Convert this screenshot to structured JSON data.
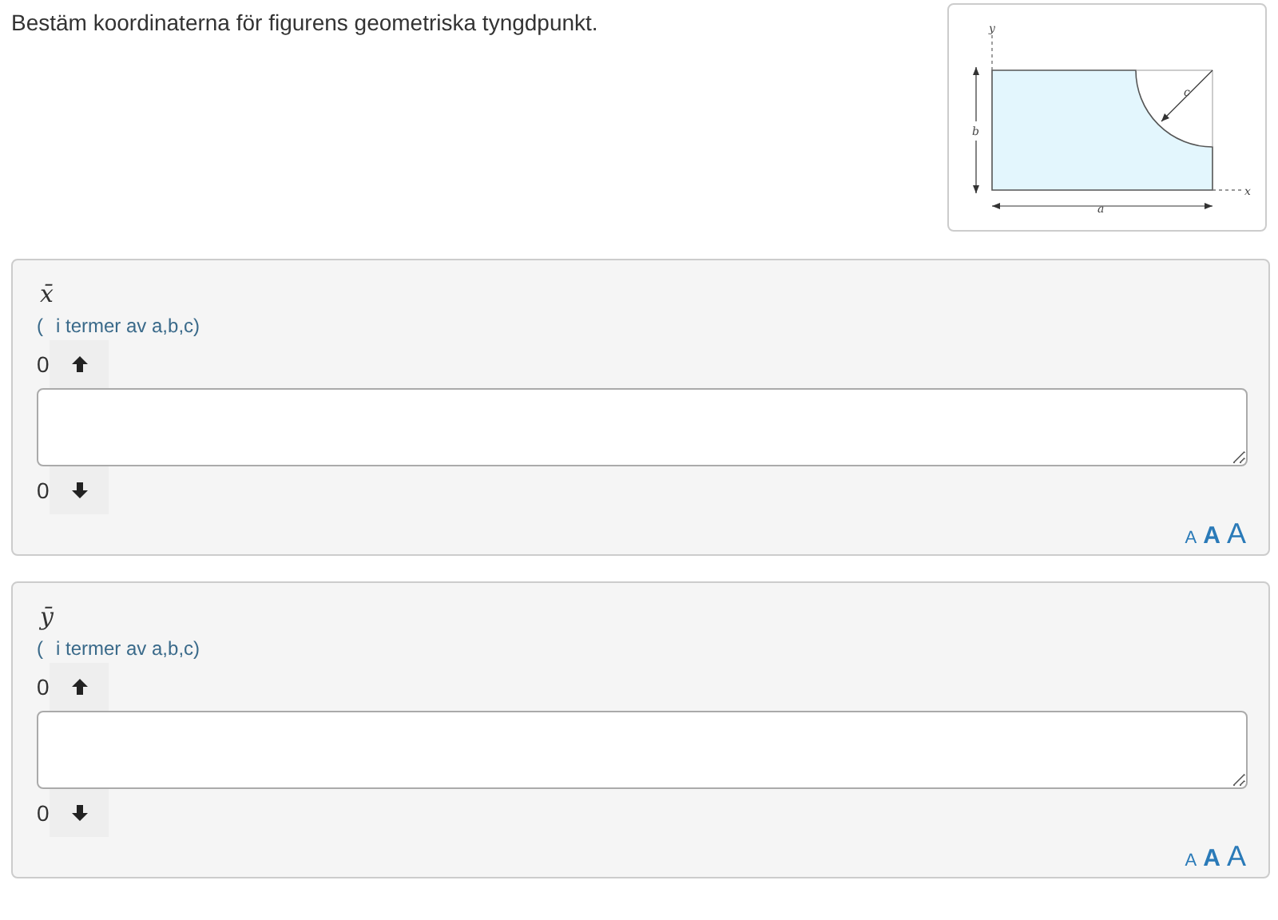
{
  "question": "Bestäm koordinaterna för figurens geometriska tyngdpunkt.",
  "figure": {
    "labels": {
      "y": "y",
      "x": "x",
      "b": "b",
      "c": "c",
      "a": "a"
    }
  },
  "answers": [
    {
      "variable": "x̄",
      "hint_open": "(",
      "hint": "i termer av a,b,c)",
      "upper_count": "0",
      "lower_count": "0",
      "font_sizes": [
        "A",
        "A",
        "A"
      ]
    },
    {
      "variable": "ȳ",
      "hint_open": "(",
      "hint": "i termer av a,b,c)",
      "upper_count": "0",
      "lower_count": "0",
      "font_sizes": [
        "A",
        "A",
        "A"
      ]
    }
  ]
}
